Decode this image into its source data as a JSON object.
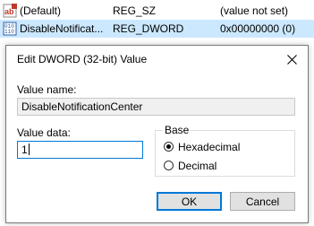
{
  "registry_rows": [
    {
      "name": "(Default)",
      "type": "REG_SZ",
      "data": "(value not set)",
      "icon": "string-value-icon",
      "selected": false
    },
    {
      "name": "DisableNotificat...",
      "type": "REG_DWORD",
      "data": "0x00000000 (0)",
      "icon": "dword-value-icon",
      "selected": true
    }
  ],
  "dialog": {
    "title": "Edit DWORD (32-bit) Value",
    "value_name_label": "Value name:",
    "value_name": "DisableNotificationCenter",
    "value_data_label": "Value data:",
    "value_data": "1",
    "base_label": "Base",
    "base_options": [
      {
        "label": "Hexadecimal",
        "selected": true
      },
      {
        "label": "Decimal",
        "selected": false
      }
    ],
    "ok_label": "OK",
    "cancel_label": "Cancel"
  },
  "colors": {
    "selection": "#cce8ff",
    "accent": "#0078d7",
    "string_icon": "#c0392b",
    "dword_icon": "#2e5ea8"
  }
}
